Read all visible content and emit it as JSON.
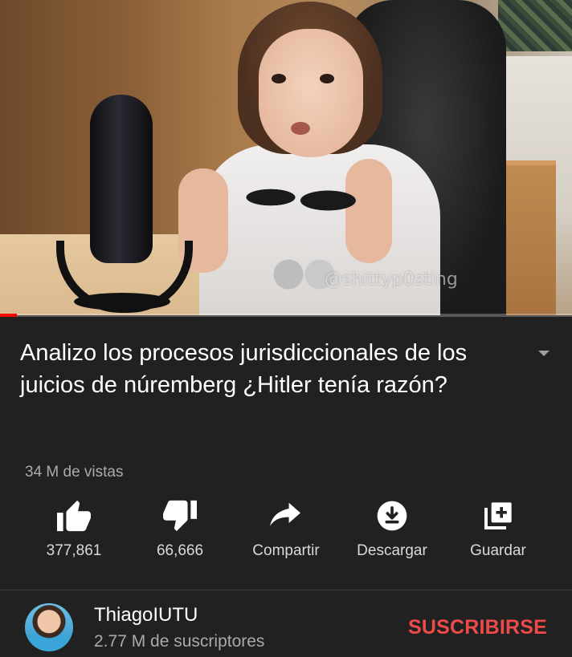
{
  "video": {
    "watermark": "@shittyp0sting",
    "progress_fraction": 0.03
  },
  "title": "Analizo los procesos jurisdiccionales de los juicios de núremberg ¿Hitler tenía razón?",
  "views": "34 M de vistas",
  "actions": {
    "like": {
      "label": "377,861",
      "icon": "thumbs-up-icon"
    },
    "dislike": {
      "label": "66,666",
      "icon": "thumbs-down-icon"
    },
    "share": {
      "label": "Compartir",
      "icon": "share-icon"
    },
    "download": {
      "label": "Descargar",
      "icon": "download-icon"
    },
    "save": {
      "label": "Guardar",
      "icon": "add-to-playlist-icon"
    }
  },
  "channel": {
    "name": "ThiagoIUTU",
    "subscribers": "2.77 M de suscriptores",
    "subscribe_label": "SUSCRIBIRSE"
  },
  "colors": {
    "background": "#212121",
    "subscribe": "#ef4a4a",
    "secondary_text": "#aaaaaa",
    "progress": "#ff0000"
  }
}
